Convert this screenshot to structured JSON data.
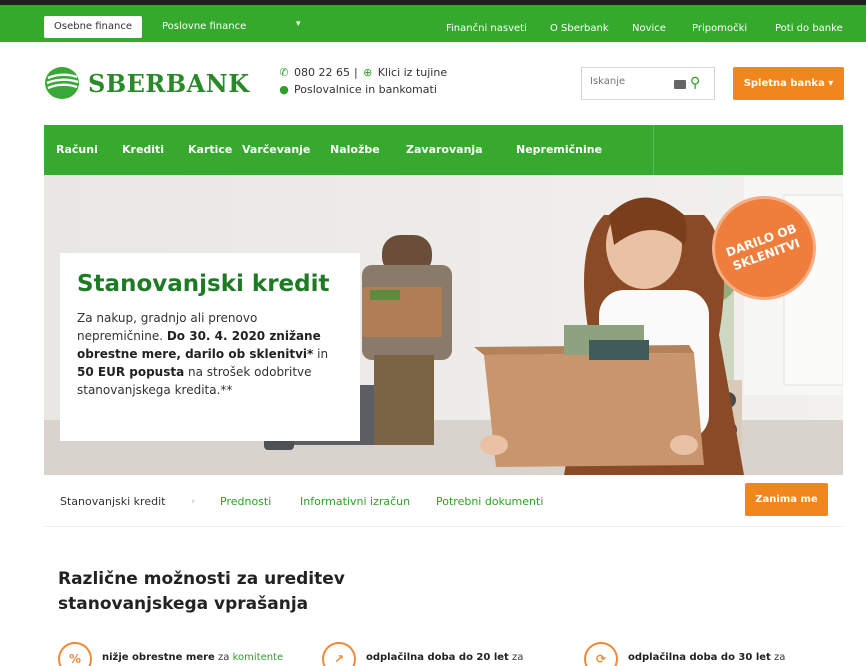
{
  "topbar": {
    "segments": [
      "Osebne finance",
      "Poslovne finance"
    ],
    "caret": "▾",
    "links": [
      "Finančni nasveti",
      "O Sberbank",
      "Novice",
      "Pripomočki",
      "Poti do banke"
    ]
  },
  "header": {
    "logo_text": "SBERBANK",
    "phone": "080 22 65",
    "separator": "|",
    "abroad": "Klici iz tujine",
    "branches": "Poslovalnice in bankomati",
    "search_placeholder": "Iskanje",
    "ebank_label": "Spletna banka ▾"
  },
  "nav": {
    "items": [
      "Računi",
      "Krediti",
      "Kartice",
      "Varčevanje",
      "Naložbe",
      "Zavarovanja",
      "Nepremičnine"
    ]
  },
  "hero": {
    "title": "Stanovanjski kredit",
    "body_1": "Za nakup, gradnjo ali prenovo nepremičnine. ",
    "body_bold_1": "Do 30. 4. 2020 znižane obrestne mere, darilo ob sklenitvi*",
    "body_2": " in ",
    "body_bold_2": "50 EUR popusta",
    "body_3": " na strošek odobritve stanovanjskega kredita.**",
    "badge": "DARILO OB SKLENITVI"
  },
  "subnav": {
    "current": "Stanovanjski kredit",
    "separator": "›",
    "links": [
      "Prednosti",
      "Informativni izračun",
      "Potrebni dokumenti"
    ],
    "cta": "Zanima me"
  },
  "section": {
    "title": "Različne možnosti za ureditev stanovanjskega vprašanja",
    "features": [
      {
        "icon": "%",
        "bold": "nižje obrestne mere",
        "plain": " za ",
        "link": "komitente"
      },
      {
        "icon": "↗",
        "bold": "odplačilna doba do 20 let",
        "plain": " za",
        "link": ""
      },
      {
        "icon": "⟳",
        "bold": "odplačilna doba do 30 let",
        "plain": " za",
        "link": ""
      }
    ]
  },
  "colors": {
    "brand_green": "#34a92c",
    "accent_orange": "#f0861c",
    "title_green": "#1f7a26"
  },
  "icons": [
    "phone-icon",
    "globe-icon",
    "location-pin-icon",
    "keyboard-icon",
    "search-icon",
    "chevron-down-icon"
  ]
}
